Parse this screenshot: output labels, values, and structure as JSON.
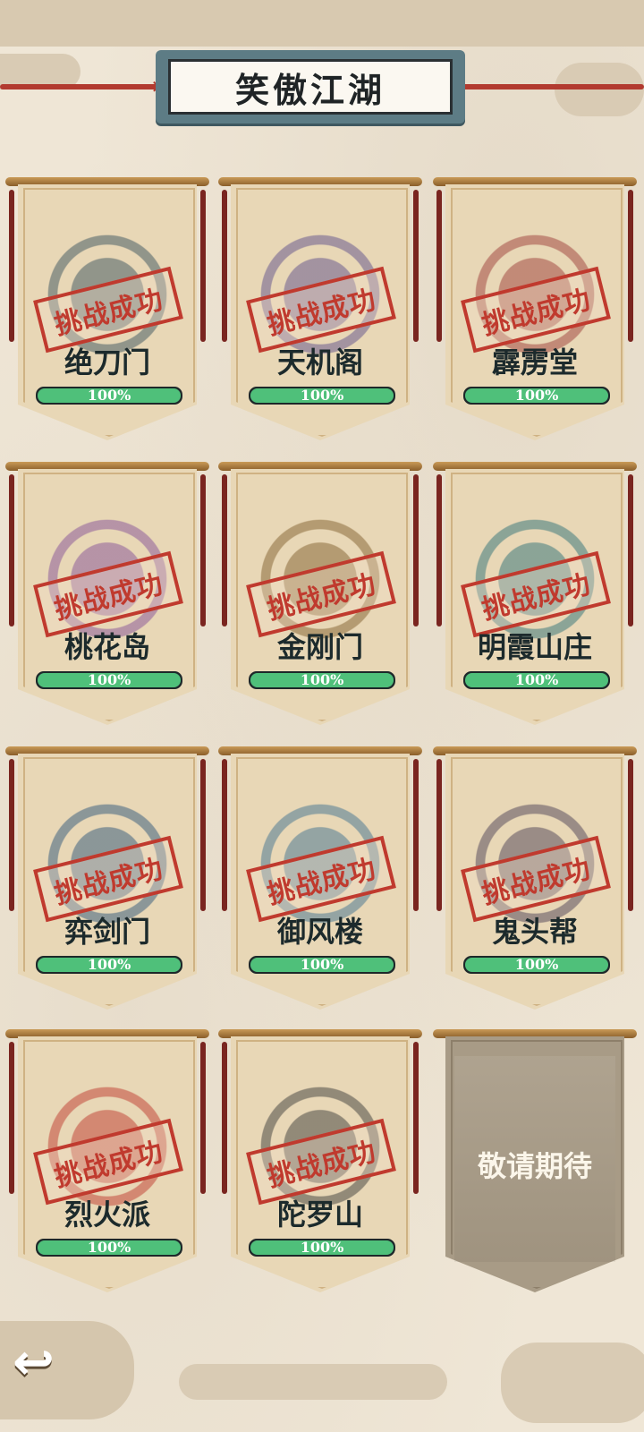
{
  "title": "笑傲江湖",
  "stamp_text": "挑战成功",
  "coming_soon": "敬请期待",
  "sects": [
    {
      "name": "绝刀门",
      "progress": 100,
      "progress_label": "100%",
      "color": "#4a5f66"
    },
    {
      "name": "天机阁",
      "progress": 100,
      "progress_label": "100%",
      "color": "#6a5b8f"
    },
    {
      "name": "霹雳堂",
      "progress": 100,
      "progress_label": "100%",
      "color": "#a34b44"
    },
    {
      "name": "桃花岛",
      "progress": 100,
      "progress_label": "100%",
      "color": "#8d5c9a"
    },
    {
      "name": "金刚门",
      "progress": 100,
      "progress_label": "100%",
      "color": "#8a6a3a"
    },
    {
      "name": "明霞山庄",
      "progress": 100,
      "progress_label": "100%",
      "color": "#3f7a7d"
    },
    {
      "name": "弈剑门",
      "progress": 100,
      "progress_label": "100%",
      "color": "#3f6280"
    },
    {
      "name": "御风楼",
      "progress": 100,
      "progress_label": "100%",
      "color": "#4f7b93"
    },
    {
      "name": "鬼头帮",
      "progress": 100,
      "progress_label": "100%",
      "color": "#5a4e5e"
    },
    {
      "name": "烈火派",
      "progress": 100,
      "progress_label": "100%",
      "color": "#c2483a"
    },
    {
      "name": "陀罗山",
      "progress": 100,
      "progress_label": "100%",
      "color": "#4c4a45"
    }
  ],
  "colors": {
    "stamp": "#c03a2e",
    "progress_fill": "#4fc07a",
    "rope": "#b23a2f"
  },
  "icons": {
    "back": "back-arrow-icon"
  }
}
